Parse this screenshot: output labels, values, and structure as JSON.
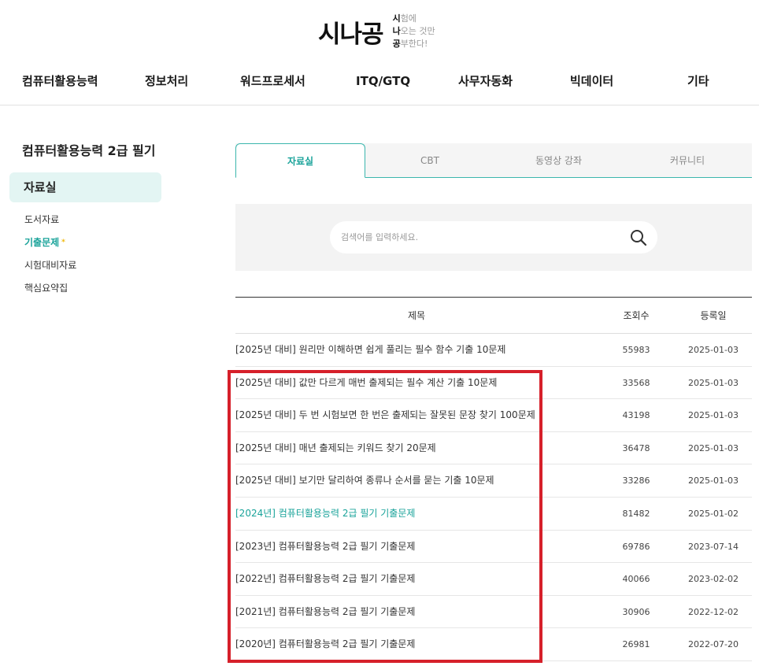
{
  "logo": {
    "main": "시나공",
    "tagline": [
      {
        "first": "시",
        "rest": "험에"
      },
      {
        "first": "나",
        "rest": "오는 것만"
      },
      {
        "first": "공",
        "rest": "부한다!"
      }
    ]
  },
  "gnb": [
    "컴퓨터활용능력",
    "정보처리",
    "워드프로세서",
    "ITQ/GTQ",
    "사무자동화",
    "빅데이터",
    "기타"
  ],
  "sidebar": {
    "title": "컴퓨터활용능력 2급 필기",
    "active": "자료실",
    "items": [
      {
        "label": "도서자료",
        "current": false
      },
      {
        "label": "기출문제",
        "current": true,
        "star": "*"
      },
      {
        "label": "시험대비자료",
        "current": false
      },
      {
        "label": "핵심요약집",
        "current": false
      }
    ]
  },
  "tabs": [
    {
      "label": "자료실",
      "active": true
    },
    {
      "label": "CBT",
      "active": false
    },
    {
      "label": "동영상 강좌",
      "active": false
    },
    {
      "label": "커뮤니티",
      "active": false
    }
  ],
  "search": {
    "placeholder": "검색어를 입력하세요.",
    "icon": "search-icon"
  },
  "table": {
    "headers": {
      "title": "제목",
      "views": "조회수",
      "date": "등록일"
    },
    "rows": [
      {
        "title": "[2025년 대비] 원리만 이해하면 쉽게 풀리는 필수 함수 기출 10문제",
        "views": "55983",
        "date": "2025-01-03",
        "highlight": false
      },
      {
        "title": "[2025년 대비] 값만 다르게 매번 출제되는 필수 계산 기출 10문제",
        "views": "33568",
        "date": "2025-01-03",
        "highlight": false
      },
      {
        "title": "[2025년 대비] 두 번 시험보면 한 번은 출제되는 잘못된 문장 찾기 100문제",
        "views": "43198",
        "date": "2025-01-03",
        "highlight": false
      },
      {
        "title": "[2025년 대비] 매년 출제되는 키워드 찾기 20문제",
        "views": "36478",
        "date": "2025-01-03",
        "highlight": false
      },
      {
        "title": "[2025년 대비] 보기만 달리하여 종류나 순서를 묻는 기출 10문제",
        "views": "33286",
        "date": "2025-01-03",
        "highlight": false
      },
      {
        "title": "[2024년] 컴퓨터활용능력 2급 필기 기출문제",
        "views": "81482",
        "date": "2025-01-02",
        "highlight": true
      },
      {
        "title": "[2023년] 컴퓨터활용능력 2급 필기 기출문제",
        "views": "69786",
        "date": "2023-07-14",
        "highlight": false
      },
      {
        "title": "[2022년] 컴퓨터활용능력 2급 필기 기출문제",
        "views": "40066",
        "date": "2023-02-02",
        "highlight": false
      },
      {
        "title": "[2021년] 컴퓨터활용능력 2급 필기 기출문제",
        "views": "30906",
        "date": "2022-12-02",
        "highlight": false
      },
      {
        "title": "[2020년] 컴퓨터활용능력 2급 필기 기출문제",
        "views": "26981",
        "date": "2022-07-20",
        "highlight": false
      }
    ]
  },
  "colors": {
    "accent": "#1aa39a",
    "highlight_border": "#d6202a",
    "active_bg": "#e3f5f3"
  }
}
